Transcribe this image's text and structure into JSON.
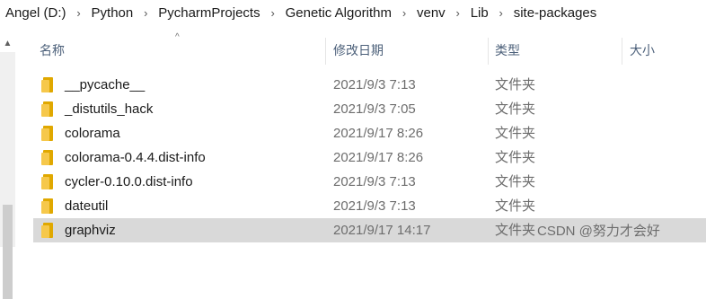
{
  "breadcrumb": [
    {
      "label": "Angel (D:)"
    },
    {
      "label": "Python"
    },
    {
      "label": "PycharmProjects"
    },
    {
      "label": "Genetic Algorithm"
    },
    {
      "label": "venv"
    },
    {
      "label": "Lib"
    },
    {
      "label": "site-packages"
    }
  ],
  "breadcrumb_separator": "›",
  "columns": {
    "name": "名称",
    "date": "修改日期",
    "type": "类型",
    "size": "大小"
  },
  "sort_icon": "sort-ascending-icon",
  "files": [
    {
      "name": "__pycache__",
      "date": "2021/9/3 7:13",
      "type": "文件夹"
    },
    {
      "name": "_distutils_hack",
      "date": "2021/9/3 7:05",
      "type": "文件夹"
    },
    {
      "name": "colorama",
      "date": "2021/9/17 8:26",
      "type": "文件夹"
    },
    {
      "name": "colorama-0.4.4.dist-info",
      "date": "2021/9/17 8:26",
      "type": "文件夹"
    },
    {
      "name": "cycler-0.10.0.dist-info",
      "date": "2021/9/3 7:13",
      "type": "文件夹"
    },
    {
      "name": "dateutil",
      "date": "2021/9/3 7:13",
      "type": "文件夹"
    },
    {
      "name": "graphviz",
      "date": "2021/9/17 14:17",
      "type": "文件夹",
      "selected": true
    }
  ],
  "watermark": "CSDN @努力才会好",
  "colors": {
    "selected_row": "#d9d9d9",
    "folder": "#f6c84b",
    "header_text": "#4c607a"
  }
}
